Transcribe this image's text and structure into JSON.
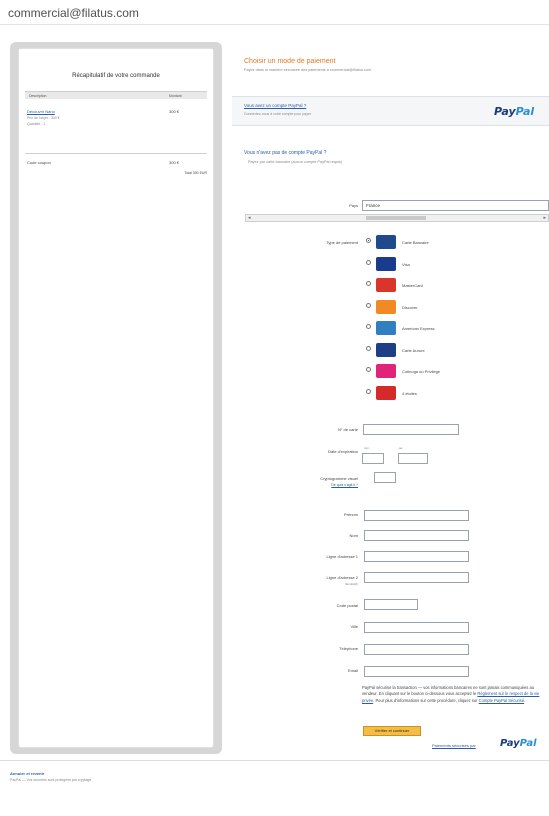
{
  "header": {
    "email": "commercial@filatus.com"
  },
  "summary": {
    "title": "Récapitulatif de votre commande",
    "col_description": "Description",
    "col_amount": "Montant",
    "item_name": "Découvrir Nano",
    "item_amount": "300 €",
    "item_price": "Prix de l'objet : 300 €",
    "item_qty": "Quantité : 1",
    "total_label": "Code coupon",
    "total_amount": "300 €",
    "currency_note": "Total 300 EUR"
  },
  "payment": {
    "title": "Choisir un mode de paiement",
    "subtitle": "Payez dans la manière sécurisée des paiements à commercial@filatus.com",
    "paypal_account_question": "Vous avez un compte PayPal ?",
    "paypal_account_sub": "Connectez-vous à votre compte pour payer",
    "no_account_title": "Vous n'avez pas de compte PayPal ?",
    "no_account_sub": "Payez par carte bancaire (aucun compte PayPal requis)"
  },
  "form": {
    "country_label": "Pays",
    "country_value": "France",
    "card_type_label": "Type de paiement",
    "cards": [
      {
        "name": "Carte Bancaire",
        "icon": "carte-bancaire-icon",
        "color": "#1f4a8c",
        "selected": true
      },
      {
        "name": "Visa",
        "icon": "visa-icon",
        "color": "#1a3a8c",
        "selected": false
      },
      {
        "name": "MasterCard",
        "icon": "mastercard-icon",
        "color": "#d9352a",
        "selected": false
      },
      {
        "name": "Discover",
        "icon": "discover-icon",
        "color": "#f08a24",
        "selected": false
      },
      {
        "name": "American Express",
        "icon": "amex-icon",
        "color": "#2f7fc1",
        "selected": false
      },
      {
        "name": "Carte Aurore",
        "icon": "carte-aurore-icon",
        "color": "#1c3f86",
        "selected": false
      },
      {
        "name": "Cofinoga ou Privilège",
        "icon": "cofinoga-icon",
        "color": "#e0247a",
        "selected": false
      },
      {
        "name": "4 étoiles",
        "icon": "4-etoiles-icon",
        "color": "#d42a2a",
        "selected": false
      }
    ],
    "card_number_label": "N° de carte",
    "expiry_label": "Date d'expiration",
    "expiry_month_hint": "mm",
    "expiry_year_hint": "aa",
    "cvv_label": "Cryptogramme visuel",
    "cvv_help": "De quoi s'agit-il ?",
    "firstname_label": "Prénom",
    "lastname_label": "Nom",
    "address1_label": "Ligne d'adresse 1",
    "address2_label": "Ligne d'adresse 2",
    "address2_optional": "(facultatif)",
    "postcode_label": "Code postal",
    "city_label": "Ville",
    "phone_label": "Téléphone",
    "email_label": "Email"
  },
  "note": {
    "text": "PayPal sécurise la transaction — vos informations bancaires ne sont jamais communiquées au vendeur. En cliquant sur le bouton ci-dessous vous acceptez le",
    "link1": "Règlement sur le respect de la vie privée",
    "text2": "Pour plus d'informations sur cette procédure, cliquez sur",
    "link2": "Compte PayPal Sécurisé"
  },
  "actions": {
    "continue_label": "Vérifier et continuer",
    "secure_link": "Paiements sécurisés par"
  },
  "brand": {
    "pay": "Pay",
    "pal": "Pal"
  },
  "footer": {
    "link": "Annuler et revenir",
    "sub": "PayPal — Vos données sont protégées par cryptage"
  }
}
